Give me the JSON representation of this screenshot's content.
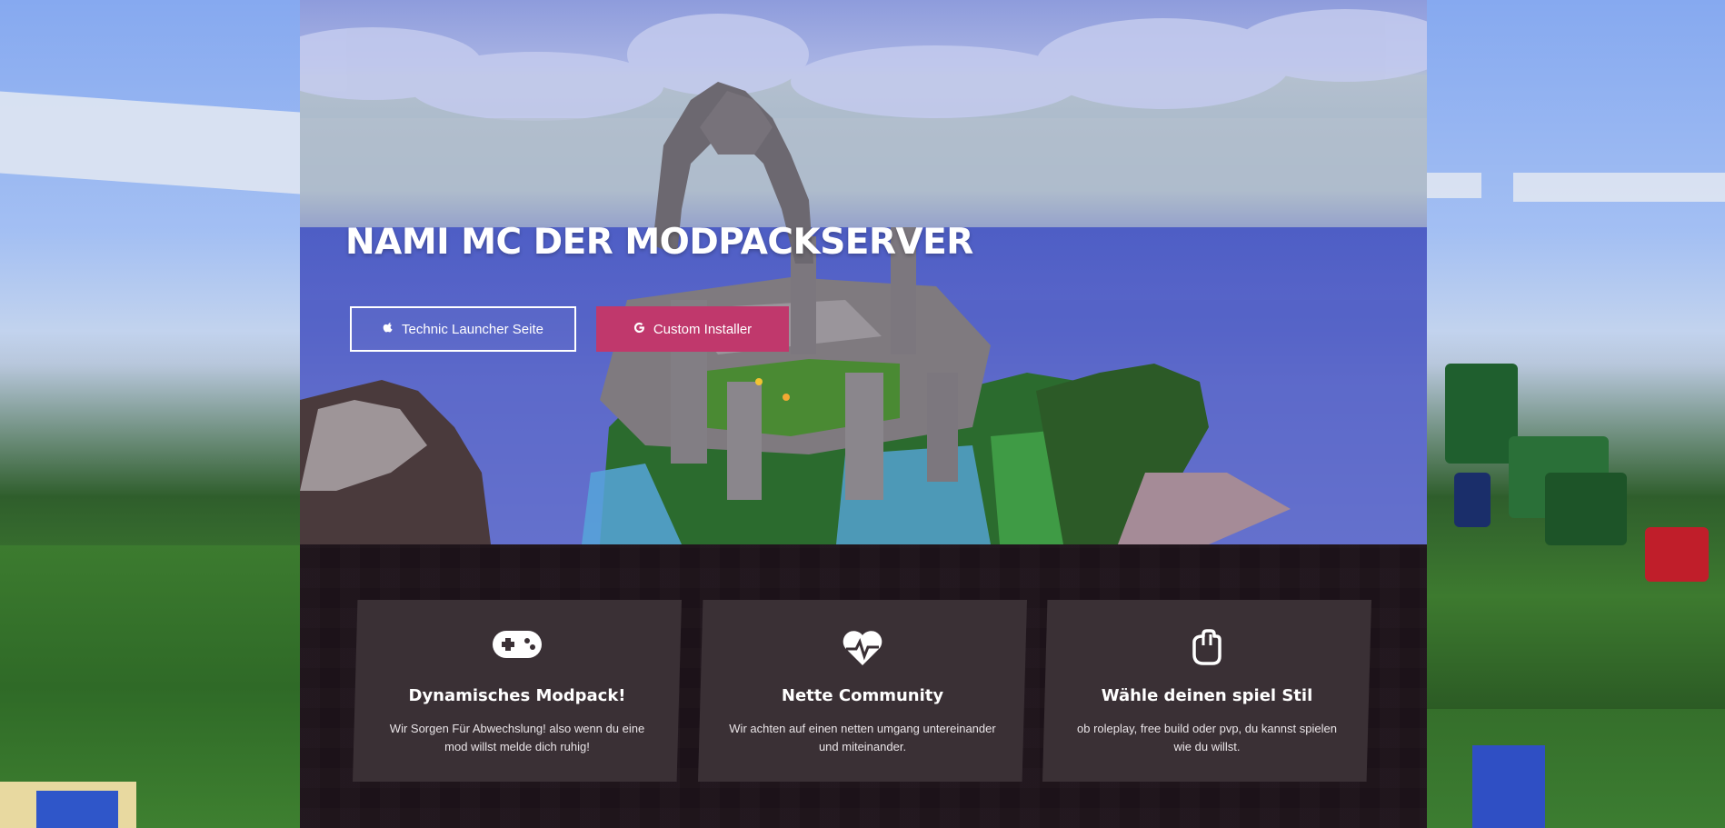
{
  "hero": {
    "title": "NAMI MC DER MODPACKSERVER",
    "buttons": [
      {
        "label": "Technic Launcher Seite",
        "icon": "apple-icon"
      },
      {
        "label": "Custom Installer",
        "icon": "google-icon"
      }
    ]
  },
  "features": [
    {
      "icon": "gamepad-icon",
      "title": "Dynamisches Modpack!",
      "text": "Wir Sorgen Für Abwechslung! also wenn du eine mod willst melde dich ruhig!"
    },
    {
      "icon": "heartbeat-icon",
      "title": "Nette Community",
      "text": "Wir achten auf einen netten umgang untereinander und miteinander."
    },
    {
      "icon": "fist-icon",
      "title": "Wähle deinen spiel Stil",
      "text": "ob roleplay, free build oder pvp, du kannst spielen wie du willst."
    }
  ],
  "colors": {
    "accent": "#c0386c",
    "dark_band": "#1d1219",
    "card": "#3a3035"
  }
}
